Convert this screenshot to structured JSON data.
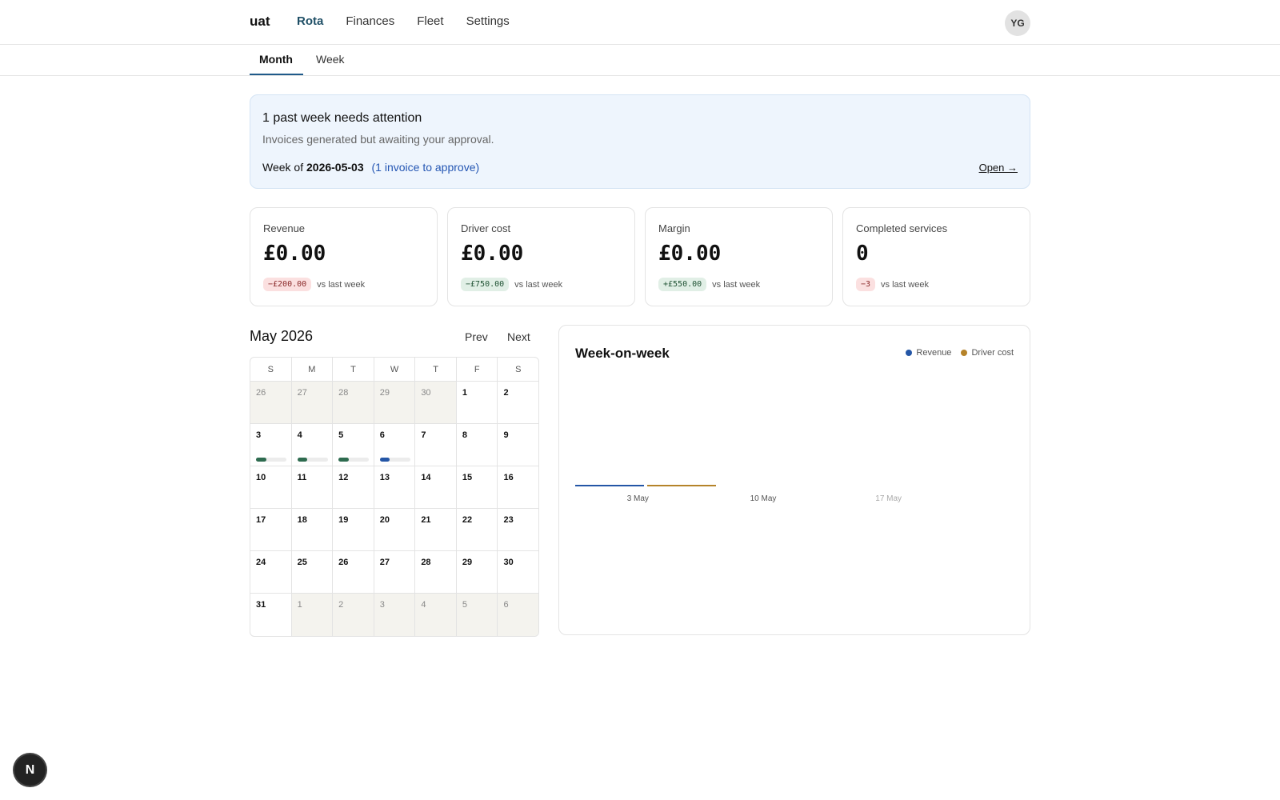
{
  "nav": {
    "brand": "uat",
    "items": [
      "Rota",
      "Finances",
      "Fleet",
      "Settings"
    ],
    "active": "Rota",
    "avatar_initials": "YG"
  },
  "subtabs": {
    "month": "Month",
    "week": "Week",
    "active": "Month"
  },
  "alert": {
    "title": "1 past week needs attention",
    "subtitle": "Invoices generated but awaiting your approval.",
    "week_prefix": "Week of",
    "week_date": "2026-05-03",
    "invoice_link": "(1 invoice to approve)",
    "open_label": "Open →"
  },
  "stats": [
    {
      "label": "Revenue",
      "value": "£0.00",
      "delta": "−£200.00",
      "trend": "neg",
      "suffix": "vs last week"
    },
    {
      "label": "Driver cost",
      "value": "£0.00",
      "delta": "−£750.00",
      "trend": "pos",
      "suffix": "vs last week"
    },
    {
      "label": "Margin",
      "value": "£0.00",
      "delta": "+£550.00",
      "trend": "pos",
      "suffix": "vs last week"
    },
    {
      "label": "Completed services",
      "value": "0",
      "delta": "−3",
      "trend": "neg",
      "suffix": "vs last week"
    }
  ],
  "calendar": {
    "title": "May 2026",
    "prev_label": "Prev",
    "next_label": "Next",
    "weekdays": [
      "S",
      "M",
      "T",
      "W",
      "T",
      "F",
      "S"
    ],
    "weeks": [
      [
        {
          "d": "26",
          "o": true
        },
        {
          "d": "27",
          "o": true
        },
        {
          "d": "28",
          "o": true
        },
        {
          "d": "29",
          "o": true
        },
        {
          "d": "30",
          "o": true
        },
        {
          "d": "1"
        },
        {
          "d": "2"
        }
      ],
      [
        {
          "d": "3",
          "bar": "green"
        },
        {
          "d": "4",
          "bar": "green"
        },
        {
          "d": "5",
          "bar": "green"
        },
        {
          "d": "6",
          "bar": "blue"
        },
        {
          "d": "7"
        },
        {
          "d": "8"
        },
        {
          "d": "9"
        }
      ],
      [
        {
          "d": "10"
        },
        {
          "d": "11"
        },
        {
          "d": "12"
        },
        {
          "d": "13"
        },
        {
          "d": "14"
        },
        {
          "d": "15"
        },
        {
          "d": "16"
        }
      ],
      [
        {
          "d": "17"
        },
        {
          "d": "18"
        },
        {
          "d": "19"
        },
        {
          "d": "20"
        },
        {
          "d": "21"
        },
        {
          "d": "22"
        },
        {
          "d": "23"
        }
      ],
      [
        {
          "d": "24"
        },
        {
          "d": "25"
        },
        {
          "d": "26"
        },
        {
          "d": "27"
        },
        {
          "d": "28"
        },
        {
          "d": "29"
        },
        {
          "d": "30"
        }
      ],
      [
        {
          "d": "31"
        },
        {
          "d": "1",
          "o": true
        },
        {
          "d": "2",
          "o": true
        },
        {
          "d": "3",
          "o": true
        },
        {
          "d": "4",
          "o": true
        },
        {
          "d": "5",
          "o": true
        },
        {
          "d": "6",
          "o": true
        }
      ]
    ],
    "bar_colors": {
      "green": "#2e6b4f",
      "blue": "#2456a6"
    },
    "bar_fill": 0.33
  },
  "chart": {
    "title": "Week-on-week",
    "legend": [
      {
        "name": "Revenue",
        "color": "#2456a6"
      },
      {
        "name": "Driver cost",
        "color": "#b5832a"
      }
    ]
  },
  "chart_data": {
    "type": "bar",
    "categories": [
      "3 May",
      "10 May",
      "17 May"
    ],
    "series": [
      {
        "name": "Revenue",
        "values": [
          0,
          0,
          0
        ]
      },
      {
        "name": "Driver cost",
        "values": [
          0,
          0,
          0
        ]
      }
    ],
    "title": "Week-on-week",
    "xlabel": "",
    "ylabel": "",
    "legend": "top-right",
    "grid": false
  },
  "next_badge": "N"
}
